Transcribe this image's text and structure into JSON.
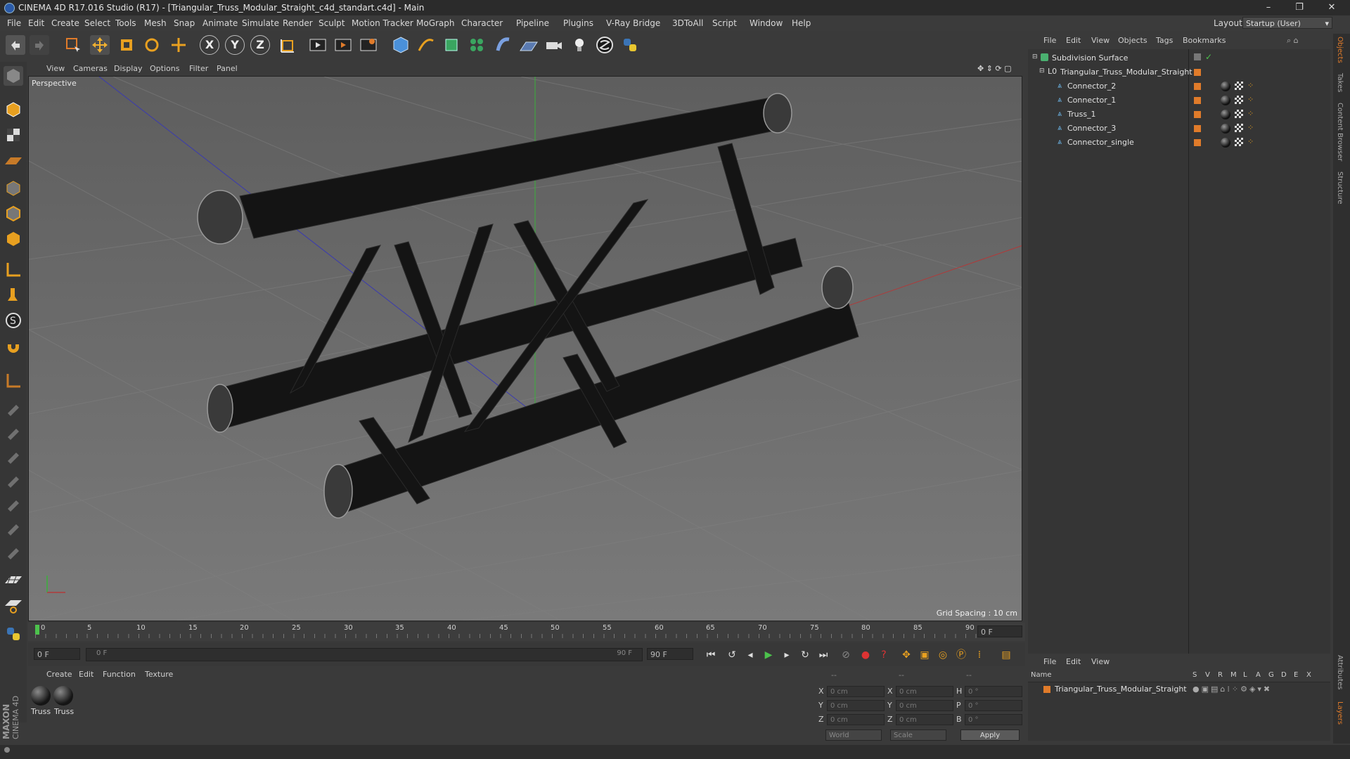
{
  "window": {
    "title": "CINEMA 4D R17.016 Studio (R17) - [Triangular_Truss_Modular_Straight_c4d_standart.c4d] - Main",
    "minimize": "–",
    "restore": "❐",
    "close": "✕"
  },
  "menubar": {
    "items": [
      "File",
      "Edit",
      "Create",
      "Select",
      "Tools",
      "Mesh",
      "Snap",
      "Animate",
      "Simulate",
      "Render",
      "Sculpt",
      "Motion Tracker",
      "MoGraph",
      "Character",
      "Pipeline",
      "Plugins",
      "V-Ray Bridge",
      "3DToAll",
      "Script",
      "Window",
      "Help"
    ],
    "layout_label": "Layout:",
    "layout_value": "Startup (User)"
  },
  "toolbar": {
    "axis_x": "X",
    "axis_y": "Y",
    "axis_z": "Z"
  },
  "viewport": {
    "menu": [
      "View",
      "Cameras",
      "Display",
      "Options",
      "Filter",
      "Panel"
    ],
    "camera_label": "Perspective",
    "grid_spacing": "Grid Spacing : 10 cm"
  },
  "timeline": {
    "ticks": [
      "0",
      "5",
      "10",
      "15",
      "20",
      "25",
      "30",
      "35",
      "40",
      "45",
      "50",
      "55",
      "60",
      "65",
      "70",
      "75",
      "80",
      "85",
      "90"
    ],
    "current_frame_right": "0 F",
    "start_field": "0 F",
    "slider_start": "0 F",
    "slider_end": "90 F",
    "end_field": "90 F"
  },
  "material_manager": {
    "menu": [
      "Create",
      "Edit",
      "Function",
      "Texture"
    ],
    "materials": [
      {
        "name": "Truss"
      },
      {
        "name": "Truss"
      }
    ]
  },
  "coordinates": {
    "header": [
      "--",
      "--",
      "--"
    ],
    "rows": [
      {
        "axis": "X",
        "pos": "0 cm",
        "axis2": "X",
        "size": "0 cm",
        "axis3": "H",
        "rot": "0 °"
      },
      {
        "axis": "Y",
        "pos": "0 cm",
        "axis2": "Y",
        "size": "0 cm",
        "axis3": "P",
        "rot": "0 °"
      },
      {
        "axis": "Z",
        "pos": "0 cm",
        "axis2": "Z",
        "size": "0 cm",
        "axis3": "B",
        "rot": "0 °"
      }
    ],
    "mode_world": "World",
    "mode_scale": "Scale",
    "apply": "Apply"
  },
  "object_manager": {
    "menu": [
      "File",
      "Edit",
      "View",
      "Objects",
      "Tags",
      "Bookmarks"
    ],
    "objects": [
      {
        "name": "Subdivision Surface"
      },
      {
        "name": "Triangular_Truss_Modular_Straight"
      },
      {
        "name": "Connector_2"
      },
      {
        "name": "Connector_1"
      },
      {
        "name": "Truss_1"
      },
      {
        "name": "Connector_3"
      },
      {
        "name": "Connector_single"
      }
    ]
  },
  "layer_manager": {
    "menu": [
      "File",
      "Edit",
      "View"
    ],
    "columns": [
      "Name",
      "S",
      "V",
      "R",
      "M",
      "L",
      "A",
      "G",
      "D",
      "E",
      "X"
    ],
    "layers": [
      {
        "name": "Triangular_Truss_Modular_Straight"
      }
    ]
  },
  "side_tabs": [
    "Objects",
    "Takes",
    "Content Browser",
    "Structure",
    "Attributes",
    "Layers"
  ],
  "brand": {
    "maxon": "MAXON",
    "product": "CINEMA 4D"
  },
  "colors": {
    "accent": "#e07b2a",
    "panel": "#3a3a3a",
    "viewport": "#6c6c6c"
  }
}
